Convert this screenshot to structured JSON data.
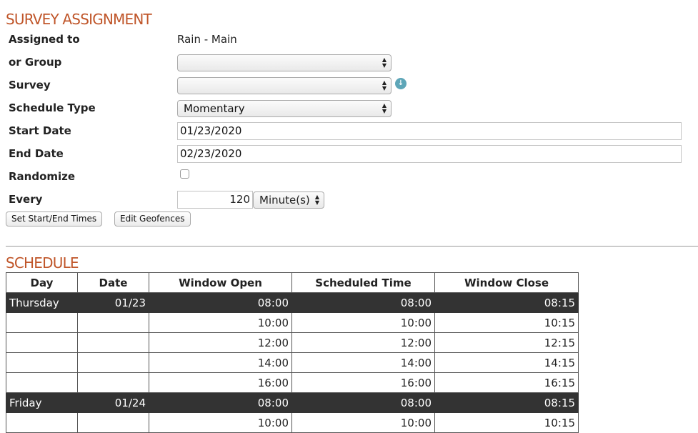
{
  "assignment": {
    "title": "SURVEY ASSIGNMENT",
    "assigned_to_label": "Assigned to",
    "assigned_to_value": "Rain - Main",
    "group_label": "or Group",
    "group_value": "",
    "survey_label": "Survey",
    "survey_value": "",
    "schedule_type_label": "Schedule Type",
    "schedule_type_value": "Momentary",
    "start_date_label": "Start Date",
    "start_date_value": "01/23/2020",
    "end_date_label": "End Date",
    "end_date_value": "02/23/2020",
    "randomize_label": "Randomize",
    "randomize_checked": false,
    "every_label": "Every",
    "every_value": "120",
    "every_unit": "Minute(s)",
    "set_times_button": "Set Start/End Times",
    "geofences_button": "Edit Geofences"
  },
  "schedule": {
    "title": "SCHEDULE",
    "headers": [
      "Day",
      "Date",
      "Window Open",
      "Scheduled Time",
      "Window Close"
    ],
    "rows": [
      {
        "day": "Thursday",
        "date": "01/23",
        "open": "08:00",
        "scheduled": "08:00",
        "close": "08:15",
        "is_day": true
      },
      {
        "day": "",
        "date": "",
        "open": "10:00",
        "scheduled": "10:00",
        "close": "10:15",
        "is_day": false
      },
      {
        "day": "",
        "date": "",
        "open": "12:00",
        "scheduled": "12:00",
        "close": "12:15",
        "is_day": false
      },
      {
        "day": "",
        "date": "",
        "open": "14:00",
        "scheduled": "14:00",
        "close": "14:15",
        "is_day": false
      },
      {
        "day": "",
        "date": "",
        "open": "16:00",
        "scheduled": "16:00",
        "close": "16:15",
        "is_day": false
      },
      {
        "day": "Friday",
        "date": "01/24",
        "open": "08:00",
        "scheduled": "08:00",
        "close": "08:15",
        "is_day": true
      },
      {
        "day": "",
        "date": "",
        "open": "10:00",
        "scheduled": "10:00",
        "close": "10:15",
        "is_day": false
      }
    ]
  },
  "icons": {
    "survey_info": "info-download-icon",
    "select_arrows": "up-down-arrows-icon"
  },
  "colors": {
    "section_title": "#c0562a",
    "day_row_bg": "#333333",
    "info_icon": "#5ea6b8"
  }
}
